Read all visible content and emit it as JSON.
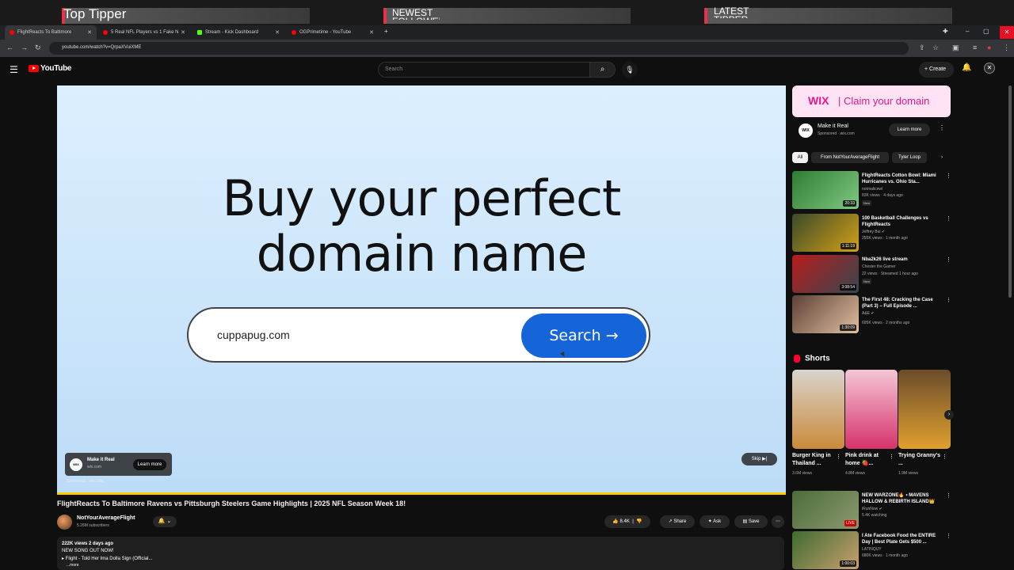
{
  "overlay": {
    "left_label": "Top Tipper",
    "mid_label": "NEWEST FOLLOWER",
    "right_label": "LATEST TIPPER"
  },
  "browser": {
    "tabs": [
      {
        "label": "FlightReacts To Baltimore",
        "active": true
      },
      {
        "label": "5 Real NFL Players vs 1 Fake N"
      },
      {
        "label": "Stream - Kick Dashboard"
      },
      {
        "label": "OGPrimetime - YouTube"
      }
    ],
    "url": "youtube.com/watch?v=QrpaXVuiXME"
  },
  "youtube": {
    "logo_text": "YouTube",
    "search_placeholder": "Search",
    "create_label": "Create"
  },
  "video": {
    "ad_headline_line1": "Buy your perfect",
    "ad_headline_line2": "domain name",
    "ad_domain_value": "cuppapug.com",
    "ad_search_label": "Search →",
    "advertiser_name": "Make it Real",
    "advertiser_domain": "wix.com",
    "learn_more": "Learn more",
    "sponsored": "Sponsored · wix.com",
    "skip_label": "Skip",
    "progress_color": "#ffcc00",
    "title": "FlightReacts To Baltimore Ravens vs Pittsburgh Steelers Game Highlights | 2025 NFL Season Week 18!",
    "channel_name": "NotYourAverageFlight",
    "channel_subs": "5.26M subscribers",
    "likes": "8.4K",
    "share_label": "Share",
    "ask_label": "Ask",
    "save_label": "Save",
    "desc_meta": "222K views  2 days ago",
    "desc_line2": "NEW SONG OUT NOW!",
    "desc_line3": "▸ Flight - Told Her Ima Dolla Sign (Official...",
    "desc_more": "...more"
  },
  "sidebar": {
    "ad_brand": "WIX",
    "ad_claim": "| Claim your domain",
    "ad_name": "Make it Real",
    "ad_sponsored": "Sponsored · wix.com",
    "ad_learn_more": "Learn more",
    "chips": [
      "All",
      "From NotYourAverageFlight",
      "Tyler Loop"
    ],
    "recs": [
      {
        "title": "FlightReacts Cotton Bowl: Miami Hurricanes vs. Ohio Sta...",
        "channel": "notmalicewl",
        "meta": "83K views · 4 days ago",
        "badge": "New",
        "duration": "20:33",
        "color": "#2e7d32"
      },
      {
        "title": "100 Basketball Challenges vs FlightReacts",
        "channel": "Jeffrey Bui ✔",
        "meta": "255K views · 1 month ago",
        "badge": "",
        "duration": "1:11:19",
        "color": "#8d6e2a"
      },
      {
        "title": "Nba2k26 live stream",
        "channel": "Chester the Gamer",
        "meta": "22 views · Streamed 1 hour ago",
        "badge": "New",
        "duration": "3:08:54",
        "color": "#b71c1c"
      },
      {
        "title": "The First 48: Cracking the Case (Part 3) – Full Episode ...",
        "channel": "A&E ✔",
        "meta": "695K views · 2 months ago",
        "badge": "",
        "duration": "1:30:09",
        "color": "#5d4037"
      }
    ],
    "shorts_header": "Shorts",
    "shorts": [
      {
        "title": "Burger King in Thailand ...",
        "views": "3.6M views",
        "color": "#c98a3a"
      },
      {
        "title": "Pink drink at home 🍓...",
        "views": "4.8M views",
        "color": "#d6336c"
      },
      {
        "title": "Trying Granny's ...",
        "views": "1.9M views",
        "color": "#b8860b"
      }
    ],
    "recs2": [
      {
        "title": "NEW WARZONE🔥 • MAVENS HALLOW & REBIRTH ISLAND👑",
        "channel": "iRunNow ✔",
        "meta": "5.4K watching",
        "badge": "LIVE",
        "duration": "",
        "color": "#4e6b3a"
      },
      {
        "title": "I Ate Facebook Food the ENTIRE Day | Best Plate Gets $500 ...",
        "channel": "LATINQUY",
        "meta": "680K views · 1 month ago",
        "badge": "",
        "duration": "1:00:03",
        "color": "#3e6b2e"
      }
    ]
  }
}
